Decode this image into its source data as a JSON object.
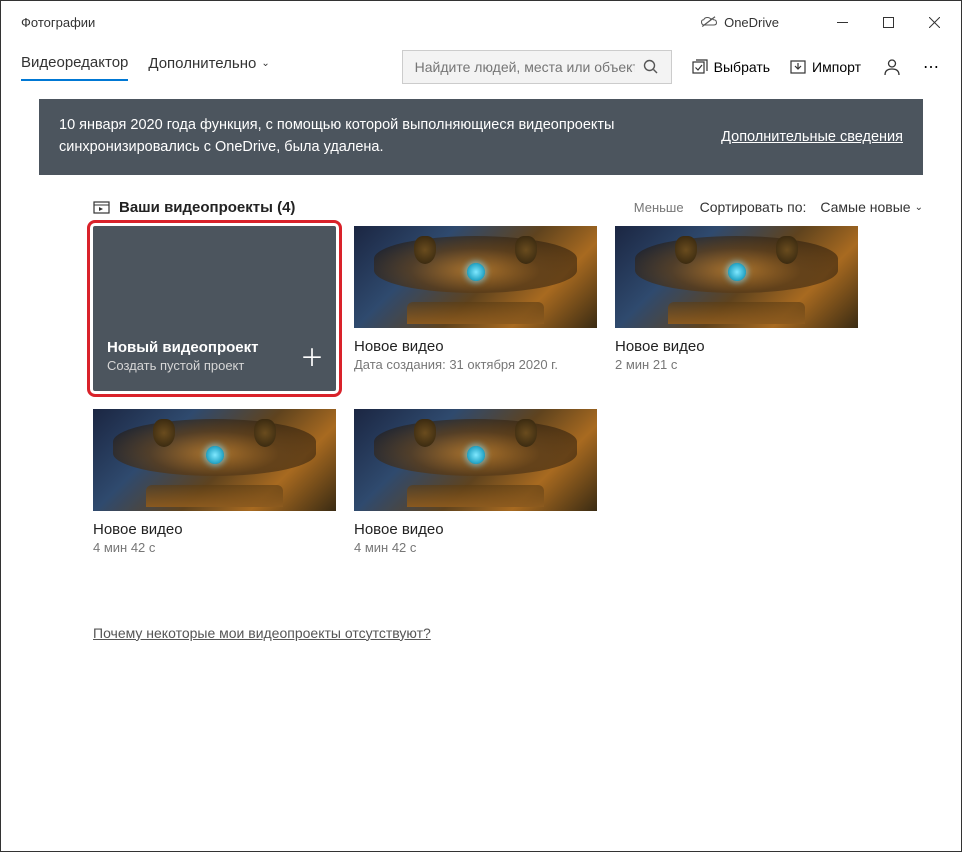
{
  "titlebar": {
    "app_name": "Фотографии",
    "onedrive_label": "OneDrive"
  },
  "toolbar": {
    "tab_active": "Видеоредактор",
    "tab_more": "Дополнительно",
    "search_placeholder": "Найдите людей, места или объект",
    "select_label": "Выбрать",
    "import_label": "Импорт"
  },
  "banner": {
    "text": "10 января 2020 года функция, с помощью которой выполняющиеся видеопроекты синхронизировались с OneDrive, была удалена.",
    "link": "Дополнительные сведения"
  },
  "section": {
    "title": "Ваши видеопроекты (4)",
    "less": "Меньше",
    "sort_label": "Сортировать по:",
    "sort_value": "Самые новые"
  },
  "newcard": {
    "title": "Новый видеопроект",
    "subtitle": "Создать пустой проект"
  },
  "cards": [
    {
      "title": "Новое видео",
      "sub": "Дата создания: 31 октября 2020 г."
    },
    {
      "title": "Новое видео",
      "sub": "2 мин 21 с"
    },
    {
      "title": "Новое видео",
      "sub": "4 мин 42 с"
    },
    {
      "title": "Новое видео",
      "sub": "4 мин 42 с"
    }
  ],
  "footer_link": "Почему некоторые мои видеопроекты отсутствуют?"
}
